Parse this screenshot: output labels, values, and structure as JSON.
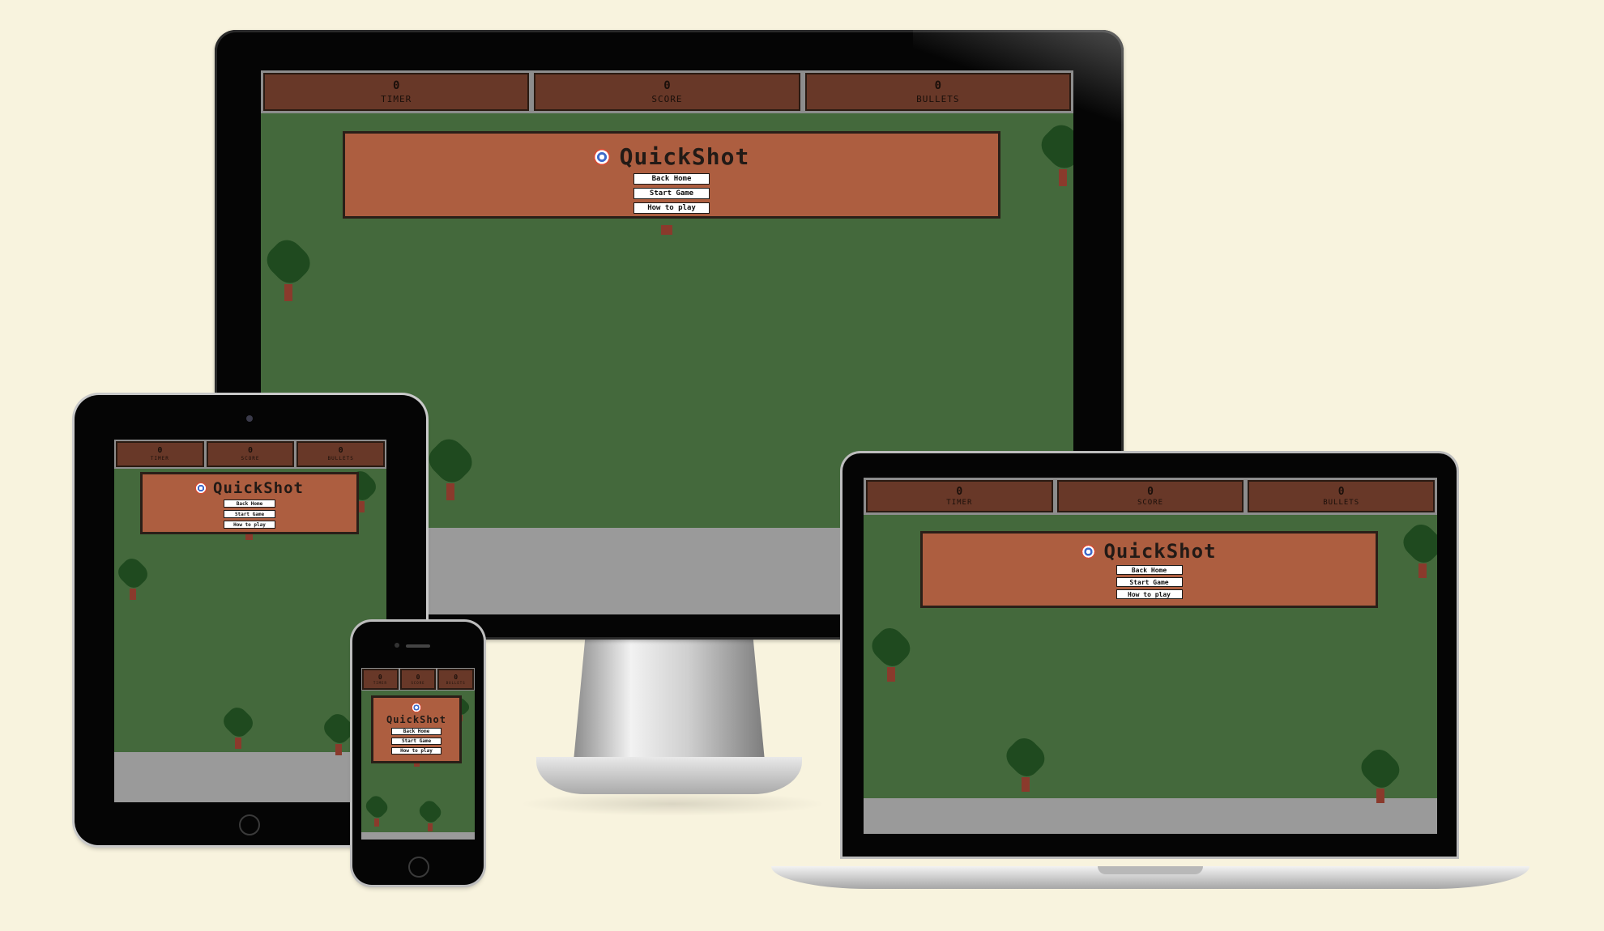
{
  "game": {
    "title": "QuickShot",
    "stats": [
      {
        "value": "0",
        "label": "TIMER"
      },
      {
        "value": "0",
        "label": "SCORE"
      },
      {
        "value": "0",
        "label": "BULLETS"
      }
    ],
    "buttons": {
      "back_home": "Back Home",
      "start_game": "Start Game",
      "how_to_play": "How to play"
    }
  },
  "colors": {
    "page_background": "#f8f3de",
    "grass": "#44693c",
    "hud_panel": "#683828",
    "menu_panel": "#ad5e40",
    "tree": "#1f4a1f",
    "trunk": "#8a3a2c"
  },
  "devices": [
    "desktop-monitor",
    "tablet",
    "laptop",
    "phone"
  ]
}
